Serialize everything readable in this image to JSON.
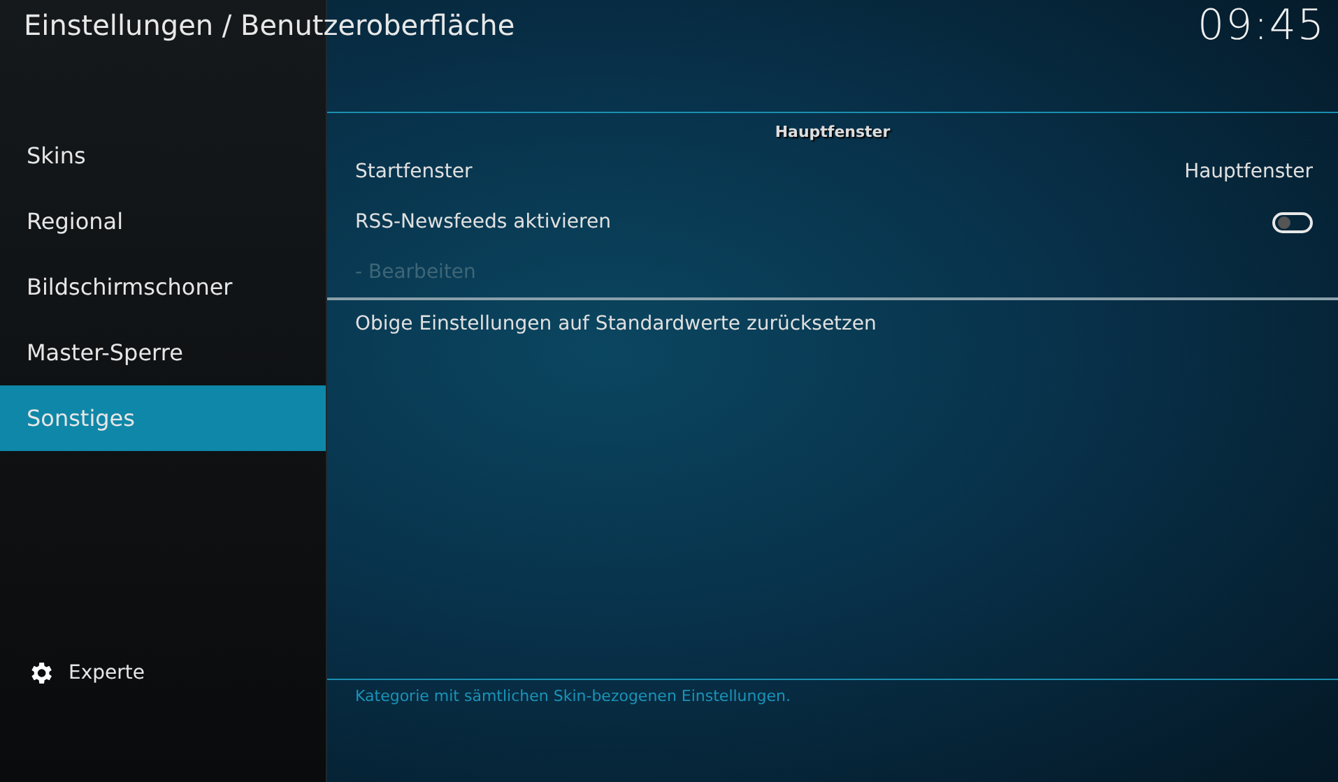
{
  "window": {
    "title": "Einstellungen / Benutzeroberfläche",
    "clock": "09:45"
  },
  "sidebar": {
    "items": [
      {
        "label": "Skins",
        "selected": false
      },
      {
        "label": "Regional",
        "selected": false
      },
      {
        "label": "Bildschirmschoner",
        "selected": false
      },
      {
        "label": "Master-Sperre",
        "selected": false
      },
      {
        "label": "Sonstiges",
        "selected": true
      }
    ],
    "level_button": {
      "label": "Experte"
    }
  },
  "settings": {
    "section": "Hauptfenster",
    "rows": [
      {
        "kind": "value",
        "label": "Startfenster",
        "value": "Hauptfenster",
        "disabled": false
      },
      {
        "kind": "toggle",
        "label": "RSS-Newsfeeds aktivieren",
        "on": false,
        "disabled": false
      },
      {
        "kind": "plain",
        "label": "- Bearbeiten",
        "disabled": true
      },
      {
        "kind": "action",
        "label": "Obige Einstellungen auf Standardwerte zurücksetzen",
        "disabled": false
      }
    ]
  },
  "description": "Kategorie mit sämtlichen Skin-bezogenen Einstellungen."
}
